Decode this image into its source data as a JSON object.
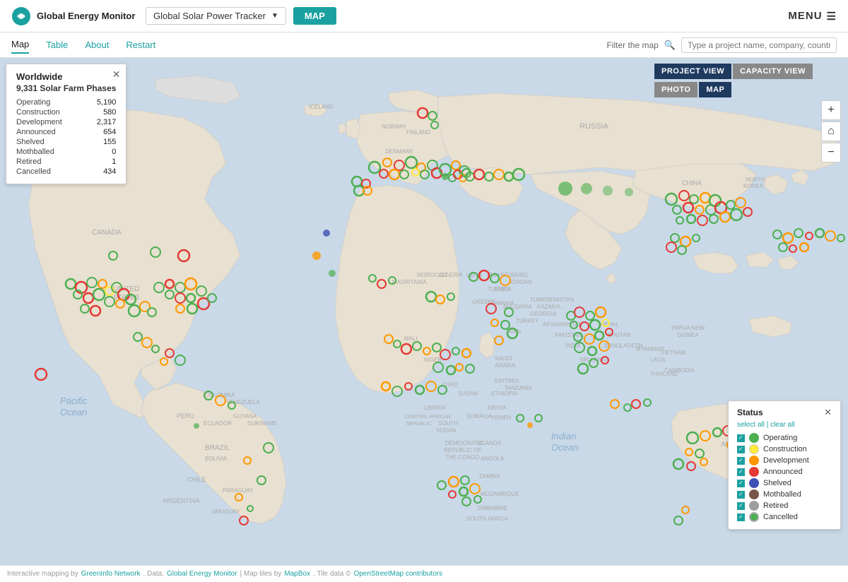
{
  "header": {
    "logo_text": "Global Energy Monitor",
    "tracker_name": "Global Solar Power Tracker",
    "map_btn": "MAP",
    "menu_btn": "MENU"
  },
  "nav": {
    "items": [
      "Map",
      "Table",
      "About",
      "Restart"
    ],
    "active": "Map",
    "filter_label": "Filter the map",
    "filter_placeholder": "Type a project name, company, country..."
  },
  "view_buttons": {
    "project_view": "PROJECT VIEW",
    "capacity_view": "CAPACITY VIEW",
    "photo": "PHOTO",
    "map": "MAP"
  },
  "zoom": {
    "plus": "+",
    "home": "⌂",
    "minus": "−"
  },
  "info_panel": {
    "title": "Worldwide",
    "subtitle": "9,331 Solar Farm Phases",
    "stats": [
      {
        "label": "Operating",
        "value": "5,190"
      },
      {
        "label": "Construction",
        "value": "580"
      },
      {
        "label": "Development",
        "value": "2,317"
      },
      {
        "label": "Announced",
        "value": "654"
      },
      {
        "label": "Shelved",
        "value": "155"
      },
      {
        "label": "Mothballed",
        "value": "0"
      },
      {
        "label": "Retired",
        "value": "1"
      },
      {
        "label": "Cancelled",
        "value": "434"
      }
    ]
  },
  "legend": {
    "title": "Status",
    "select_all": "select all",
    "clear_all": "clear all",
    "items": [
      {
        "label": "Operating",
        "color": "#4caf50",
        "checked": true
      },
      {
        "label": "Construction",
        "color": "#ffeb3b",
        "checked": true
      },
      {
        "label": "Development",
        "color": "#ff9800",
        "checked": true
      },
      {
        "label": "Announced",
        "color": "#e53935",
        "checked": true
      },
      {
        "label": "Shelved",
        "color": "#3f51b5",
        "checked": true
      },
      {
        "label": "Mothballed",
        "color": "#795548",
        "checked": true
      },
      {
        "label": "Retired",
        "color": "#9e9e9e",
        "checked": true
      },
      {
        "label": "Cancelled",
        "color": "#4caf50",
        "checked": true
      }
    ]
  },
  "ocean_labels": [
    {
      "text": "Pacific\nOcean",
      "left": "7%",
      "top": "57%"
    },
    {
      "text": "Indian\nOcean",
      "left": "65%",
      "top": "60%"
    }
  ],
  "footer": {
    "text": "Interactive mapping by",
    "greeninfo": "GreenInfo Network",
    "data_label": ". Data:",
    "gem": "Global Energy Monitor",
    "maptiles": " | Map tiles by",
    "mapbox": "MapBox",
    "tiledata": ". Tile data ©",
    "osm": "OpenStreetMap contributors"
  }
}
